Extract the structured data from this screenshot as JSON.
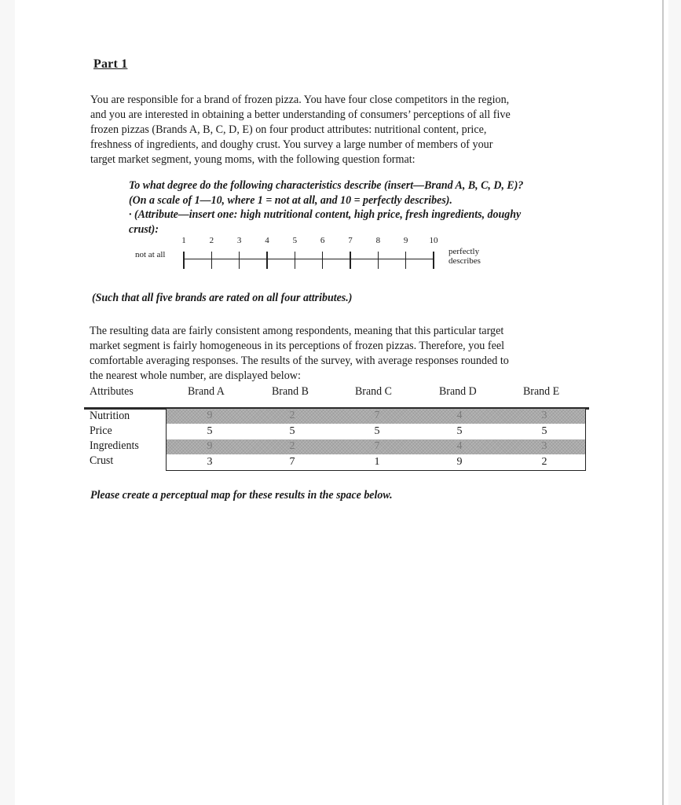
{
  "document": {
    "part_title": "Part 1",
    "intro_lines": [
      "You are responsible for a brand of frozen pizza.  You have four close competitors in the region,",
      "and you are interested in obtaining a better understanding of consumers’ perceptions of all five",
      "frozen pizzas (Brands A, B, C, D, E) on four product attributes: nutritional content, price,",
      "freshness of ingredients, and doughy crust.  You survey a large number of members of your",
      "target market segment, young moms, with the following question format:"
    ],
    "question_lines": [
      "To what degree do the following characteristics describe (insert—Brand A, B, C, D, E)?",
      "(On a scale of 1—10, where 1 = not at all, and 10 = perfectly describes).",
      "· (Attribute—insert one: high nutritional content, high price, fresh ingredients, doughy",
      "crust):"
    ],
    "scale": {
      "numbers": [
        "1",
        "2",
        "3",
        "4",
        "5",
        "6",
        "7",
        "8",
        "9",
        "10"
      ],
      "left_label": "not at all",
      "right_label_line1": "perfectly",
      "right_label_line2": "describes"
    },
    "such_that": "(Such that all five brands are rated on all four attributes.)",
    "results_lines": [
      "The resulting data are fairly consistent among respondents, meaning that this particular target",
      "market segment is fairly homogeneous in its perceptions of frozen pizzas.  Therefore, you feel",
      "comfortable averaging responses.  The results of the survey, with average responses rounded to",
      "the nearest whole number, are displayed below:"
    ],
    "table": {
      "headers": [
        "Attributes",
        "Brand A",
        "Brand B",
        "Brand C",
        "Brand D",
        "Brand E"
      ],
      "rows": [
        {
          "label": "Nutrition",
          "values": [
            "9",
            "2",
            "7",
            "4",
            "3"
          ],
          "shaded": true
        },
        {
          "label": "Price",
          "values": [
            "5",
            "5",
            "5",
            "5",
            "5"
          ],
          "shaded": false
        },
        {
          "label": "Ingredients",
          "values": [
            "9",
            "2",
            "7",
            "4",
            "3"
          ],
          "shaded": true
        },
        {
          "label": "Crust",
          "values": [
            "3",
            "7",
            "1",
            "9",
            "2"
          ],
          "shaded": false
        }
      ]
    },
    "footer_prompt": "Please create a perceptual map for these results in the space below."
  }
}
